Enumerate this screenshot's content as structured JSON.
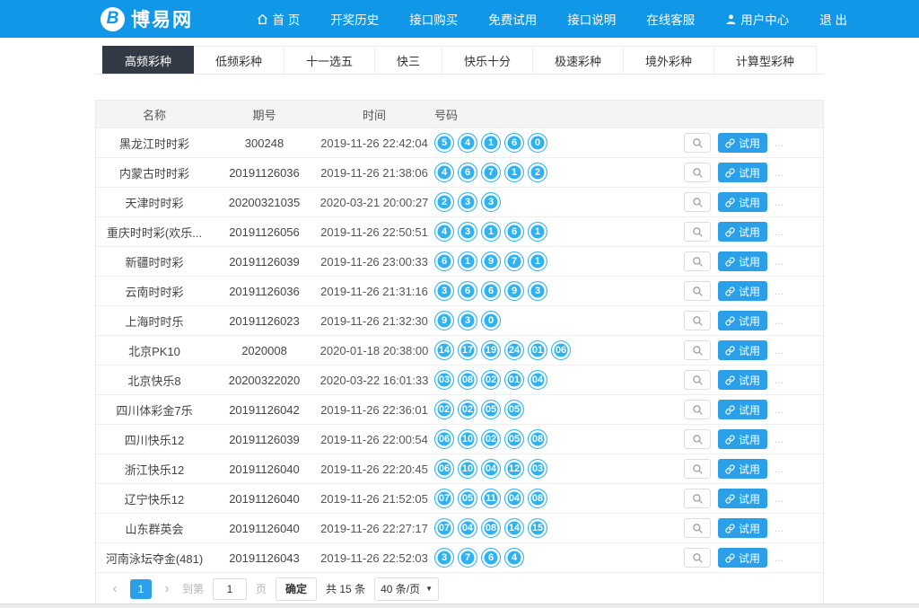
{
  "colors": {
    "header_blue": "#1097e7",
    "ball_blue": "#2eb2f2",
    "button_blue": "#2b9fe8",
    "tab_active_bg": "#333a45"
  },
  "header": {
    "logo_letter": "B",
    "logo_text": "博易网",
    "nav": [
      {
        "label": "首 页",
        "icon": "home-icon"
      },
      {
        "label": "开奖历史"
      },
      {
        "label": "接口购买"
      },
      {
        "label": "免费试用"
      },
      {
        "label": "接口说明"
      },
      {
        "label": "在线客服"
      },
      {
        "label": "用户中心",
        "icon": "user-icon"
      },
      {
        "label": "退 出"
      }
    ]
  },
  "tabs": [
    {
      "label": "高频彩种",
      "active": true
    },
    {
      "label": "低频彩种",
      "active": false
    },
    {
      "label": "十一选五",
      "active": false
    },
    {
      "label": "快三",
      "active": false
    },
    {
      "label": "快乐十分",
      "active": false
    },
    {
      "label": "极速彩种",
      "active": false
    },
    {
      "label": "境外彩种",
      "active": false
    },
    {
      "label": "计算型彩种",
      "active": false
    }
  ],
  "table": {
    "columns": {
      "name": "名称",
      "issue": "期号",
      "time": "时间",
      "numbers": "号码"
    },
    "trial_label": "试用",
    "row_ellipsis": "...",
    "rows": [
      {
        "name": "黑龙江时时彩",
        "issue": "300248",
        "time": "2019-11-26 22:42:04",
        "numbers": [
          "5",
          "4",
          "1",
          "6",
          "0"
        ]
      },
      {
        "name": "内蒙古时时彩",
        "issue": "20191126036",
        "time": "2019-11-26 21:38:06",
        "numbers": [
          "4",
          "6",
          "7",
          "1",
          "2"
        ]
      },
      {
        "name": "天津时时彩",
        "issue": "20200321035",
        "time": "2020-03-21 20:00:27",
        "numbers": [
          "2",
          "3",
          "3"
        ]
      },
      {
        "name": "重庆时时彩(欢乐...",
        "issue": "20191126056",
        "time": "2019-11-26 22:50:51",
        "numbers": [
          "4",
          "3",
          "1",
          "6",
          "1"
        ]
      },
      {
        "name": "新疆时时彩",
        "issue": "20191126039",
        "time": "2019-11-26 23:00:33",
        "numbers": [
          "6",
          "1",
          "9",
          "7",
          "1"
        ]
      },
      {
        "name": "云南时时彩",
        "issue": "20191126036",
        "time": "2019-11-26 21:31:16",
        "numbers": [
          "3",
          "6",
          "6",
          "9",
          "3"
        ]
      },
      {
        "name": "上海时时乐",
        "issue": "20191126023",
        "time": "2019-11-26 21:32:30",
        "numbers": [
          "9",
          "3",
          "0"
        ]
      },
      {
        "name": "北京PK10",
        "issue": "2020008",
        "time": "2020-01-18 20:38:00",
        "numbers": [
          "14",
          "17",
          "19",
          "24",
          "01",
          "06"
        ]
      },
      {
        "name": "北京快乐8",
        "issue": "20200322020",
        "time": "2020-03-22 16:01:33",
        "numbers": [
          "03",
          "08",
          "02",
          "01",
          "04"
        ]
      },
      {
        "name": "四川体彩金7乐",
        "issue": "20191126042",
        "time": "2019-11-26 22:36:01",
        "numbers": [
          "02",
          "02",
          "05",
          "05"
        ]
      },
      {
        "name": "四川快乐12",
        "issue": "20191126039",
        "time": "2019-11-26 22:00:54",
        "numbers": [
          "06",
          "10",
          "02",
          "05",
          "08"
        ]
      },
      {
        "name": "浙江快乐12",
        "issue": "20191126040",
        "time": "2019-11-26 22:20:45",
        "numbers": [
          "06",
          "10",
          "04",
          "12",
          "03"
        ]
      },
      {
        "name": "辽宁快乐12",
        "issue": "20191126040",
        "time": "2019-11-26 21:52:05",
        "numbers": [
          "07",
          "05",
          "11",
          "04",
          "08"
        ]
      },
      {
        "name": "山东群英会",
        "issue": "20191126040",
        "time": "2019-11-26 22:27:17",
        "numbers": [
          "07",
          "04",
          "08",
          "14",
          "15"
        ]
      },
      {
        "name": "河南泳坛夺金(481)",
        "issue": "20191126043",
        "time": "2019-11-26 22:52:03",
        "numbers": [
          "3",
          "7",
          "6",
          "4"
        ]
      }
    ]
  },
  "pagination": {
    "prev": "‹",
    "current_page": "1",
    "next": "›",
    "goto_label": "到第",
    "goto_value": "1",
    "page_unit": "页",
    "confirm_label": "确定",
    "total_label": "共 15 条",
    "per_page_label": "40 条/页",
    "caret": "▼"
  }
}
